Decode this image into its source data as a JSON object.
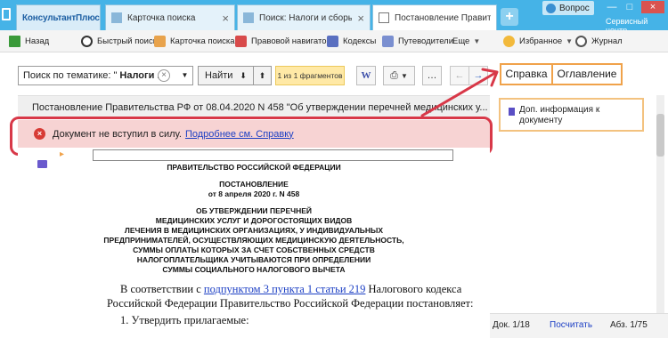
{
  "titlebar": {
    "logo": "КонсультантПлюс",
    "tabs": [
      {
        "label": "Карточка поиска"
      },
      {
        "label": "Поиск: Налоги и сборы, Не вст..."
      },
      {
        "label": "Постановление Правительст..."
      }
    ],
    "question_label": "Вопрос",
    "service_center": "Сервисный центр",
    "colors": {
      "bar": "#45b3e7",
      "accent": "#f0a24a",
      "alert": "#d83848"
    }
  },
  "toolbar": {
    "back": "Назад",
    "quick_search": "Быстрый поиск",
    "search_card": "Карточка поиска",
    "legal_navigator": "Правовой навигатор",
    "codes": "Кодексы",
    "guides": "Путеводители",
    "more": "Еще",
    "favorites": "Избранное",
    "journal": "Журнал"
  },
  "search": {
    "prefix": "Поиск по тематике: \"",
    "value": "Налоги ...",
    "find_label": "Найти",
    "fragments": "1 из 1 фрагментов",
    "w_label": "W",
    "more_label": "…",
    "spravka": "Справка",
    "oglavlenie": "Оглавление"
  },
  "document": {
    "header": "Постановление Правительства РФ от 08.04.2020 N 458 \"Об утверждении перечней медицинских у...",
    "alert_text": "Документ не вступил в силу.",
    "alert_link": "Подробнее см. Справку",
    "gov": "ПРАВИТЕЛЬСТВО РОССИЙСКОЙ ФЕДЕРАЦИИ",
    "decree": "ПОСТАНОВЛЕНИЕ",
    "date": "от 8 апреля 2020 г. N 458",
    "title_lines": [
      "ОБ УТВЕРЖДЕНИИ ПЕРЕЧНЕЙ",
      "МЕДИЦИНСКИХ УСЛУГ И ДОРОГОСТОЯЩИХ ВИДОВ",
      "ЛЕЧЕНИЯ В МЕДИЦИНСКИХ ОРГАНИЗАЦИЯХ, У ИНДИВИДУАЛЬНЫХ",
      "ПРЕДПРИНИМАТЕЛЕЙ, ОСУЩЕСТВЛЯЮЩИХ МЕДИЦИНСКУЮ ДЕЯТЕЛЬНОСТЬ,",
      "СУММЫ ОПЛАТЫ КОТОРЫХ ЗА СЧЕТ СОБСТВЕННЫХ СРЕДСТВ",
      "НАЛОГОПЛАТЕЛЬЩИКА УЧИТЫВАЮТСЯ ПРИ ОПРЕДЕЛЕНИИ",
      "СУММЫ СОЦИАЛЬНОГО НАЛОГОВОГО ВЫЧЕТА"
    ],
    "para1_start": "В соответствии с ",
    "para1_link": "подпунктом 3 пункта 1 статьи 219",
    "para1_end": " Налогового кодекса",
    "para1_line2": "Российской Федерации Правительство Российской Федерации постановляет:",
    "para2": "1. Утвердить прилагаемые:"
  },
  "right_panel": {
    "info_text": "Доп. информация к документу",
    "doc_pos": "Док. 1/18",
    "count": "Посчитать",
    "para_pos": "Абз. 1/75"
  }
}
